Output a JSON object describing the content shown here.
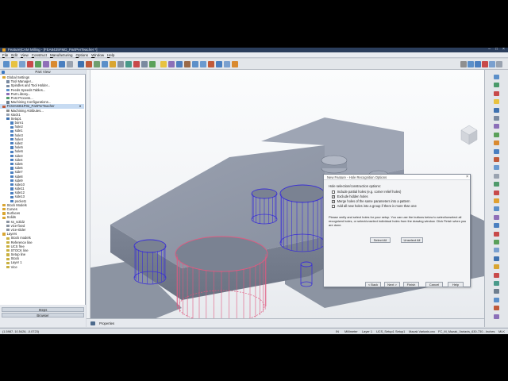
{
  "window": {
    "title": "Feature|CAM Milling - [FEA8435FMD_PartPerTeacher *]",
    "controls": [
      "–",
      "□",
      "×"
    ]
  },
  "menu": [
    "File",
    "Edit",
    "View",
    "Construct",
    "Manufacturing",
    "Options",
    "Window",
    "Help"
  ],
  "part_view": {
    "header": "Part View",
    "tree": [
      {
        "label": "Global Settings",
        "depth": 0,
        "icon": "folder-icon"
      },
      {
        "label": "Tool Manager...",
        "depth": 1,
        "icon": "tool-icon"
      },
      {
        "label": "Spindles and Tool Holder...",
        "depth": 1,
        "icon": "tool-icon"
      },
      {
        "label": "Feeds Speeds Tables...",
        "depth": 1,
        "icon": "table-icon"
      },
      {
        "label": "Part Library...",
        "depth": 1,
        "icon": "library-icon"
      },
      {
        "label": "Post Process...",
        "depth": 1,
        "icon": "post-icon"
      },
      {
        "label": "Machining Configurations...",
        "depth": 1,
        "icon": "config-icon"
      },
      {
        "label": "FCMA8351P02_PartPerTeacher",
        "depth": 0,
        "icon": "part-icon",
        "selected": true
      },
      {
        "label": "Machining Attributes...",
        "depth": 1,
        "icon": "attr-icon"
      },
      {
        "label": "stock1",
        "depth": 1,
        "icon": "stock-icon"
      },
      {
        "label": "Setup1",
        "depth": 1,
        "icon": "setup-icon"
      },
      {
        "label": "bore1",
        "depth": 2,
        "icon": "feature-icon"
      },
      {
        "label": "hole2",
        "depth": 2,
        "icon": "feature-icon"
      },
      {
        "label": "side1",
        "depth": 2,
        "icon": "feature-icon"
      },
      {
        "label": "hole3",
        "depth": 2,
        "icon": "feature-icon"
      },
      {
        "label": "hole4",
        "depth": 2,
        "icon": "feature-icon"
      },
      {
        "label": "side2",
        "depth": 2,
        "icon": "feature-icon"
      },
      {
        "label": "hole5",
        "depth": 2,
        "icon": "feature-icon"
      },
      {
        "label": "hole6",
        "depth": 2,
        "icon": "feature-icon"
      },
      {
        "label": "side3",
        "depth": 2,
        "icon": "feature-icon"
      },
      {
        "label": "side4",
        "depth": 2,
        "icon": "feature-icon"
      },
      {
        "label": "side5",
        "depth": 2,
        "icon": "feature-icon"
      },
      {
        "label": "side6",
        "depth": 2,
        "icon": "feature-icon"
      },
      {
        "label": "side7",
        "depth": 2,
        "icon": "feature-icon"
      },
      {
        "label": "side8",
        "depth": 2,
        "icon": "feature-icon"
      },
      {
        "label": "side9",
        "depth": 2,
        "icon": "feature-icon"
      },
      {
        "label": "side10",
        "depth": 2,
        "icon": "feature-icon"
      },
      {
        "label": "side11",
        "depth": 2,
        "icon": "feature-icon"
      },
      {
        "label": "side12",
        "depth": 2,
        "icon": "feature-icon"
      },
      {
        "label": "side13",
        "depth": 2,
        "icon": "feature-icon"
      },
      {
        "label": "pocket1",
        "depth": 2,
        "icon": "feature-icon"
      },
      {
        "label": "Stock Models",
        "depth": 0,
        "icon": "folder-icon"
      },
      {
        "label": "Curves",
        "depth": 0,
        "icon": "folder-icon"
      },
      {
        "label": "Surfaces",
        "depth": 0,
        "icon": "folder-icon"
      },
      {
        "label": "Solids",
        "depth": 0,
        "icon": "folder-icon"
      },
      {
        "label": "ss_solid2",
        "depth": 1,
        "icon": "solid-icon"
      },
      {
        "label": "vice-fixed",
        "depth": 1,
        "icon": "solid-icon"
      },
      {
        "label": "vice-slider",
        "depth": 1,
        "icon": "solid-icon"
      },
      {
        "label": "Layers",
        "depth": 0,
        "icon": "folder-icon"
      },
      {
        "label": "Stock models",
        "depth": 1,
        "icon": "layer-icon"
      },
      {
        "label": "Reference line",
        "depth": 1,
        "icon": "layer-icon"
      },
      {
        "label": "UCS free",
        "depth": 1,
        "icon": "layer-icon"
      },
      {
        "label": "STOCK line",
        "depth": 1,
        "icon": "layer-icon"
      },
      {
        "label": "Setup line",
        "depth": 1,
        "icon": "layer-icon"
      },
      {
        "label": "Stock",
        "depth": 1,
        "icon": "layer-icon"
      },
      {
        "label": "Layer 1",
        "depth": 1,
        "icon": "layer-icon"
      },
      {
        "label": "Vice",
        "depth": 1,
        "icon": "layer-icon"
      }
    ],
    "tabs": [
      "Steps",
      "Browser"
    ]
  },
  "dialog": {
    "title": "New Feature - Hole Recognition Options",
    "heading": "Hole selection/construction options:",
    "options": [
      {
        "label": "Include partial holes (e.g. corner relief holes)",
        "checked": false
      },
      {
        "label": "Exclude hidden holes",
        "checked": true
      },
      {
        "label": "Merge holes of the same parameters into a pattern",
        "checked": true
      },
      {
        "label": "Add all new holes into a group if there is more than one",
        "checked": false
      }
    ],
    "note": "Please verify and select holes for your setup. You can use the buttons below to select/unselect all recognized holes, or select/unselect individual holes from the drawing window. Click Finish when you are done.",
    "select_all": "Select All",
    "unselect_all": "Unselect All",
    "back": "< Back",
    "next": "Next >",
    "finish": "Finish",
    "cancel": "Cancel",
    "help": "Help"
  },
  "properties": "Properties",
  "status": {
    "coords": "(1.5987, 10.5426, -0.0723)",
    "units": "IN",
    "mode": "Millimeter",
    "layer": "Layer 1",
    "ucs": "UCS_Setup1",
    "setup": "Setup1",
    "machine": "Mazak Variaxis.cnc",
    "post": "FC_M_Mazak_Variaxis_630-730...",
    "tool": "Inches",
    "mode2": "MLK"
  },
  "colors": {
    "selected_holes": "#3a2fd6",
    "highlighted_bore": "#e05a80",
    "part_body": "#8e96a6"
  }
}
